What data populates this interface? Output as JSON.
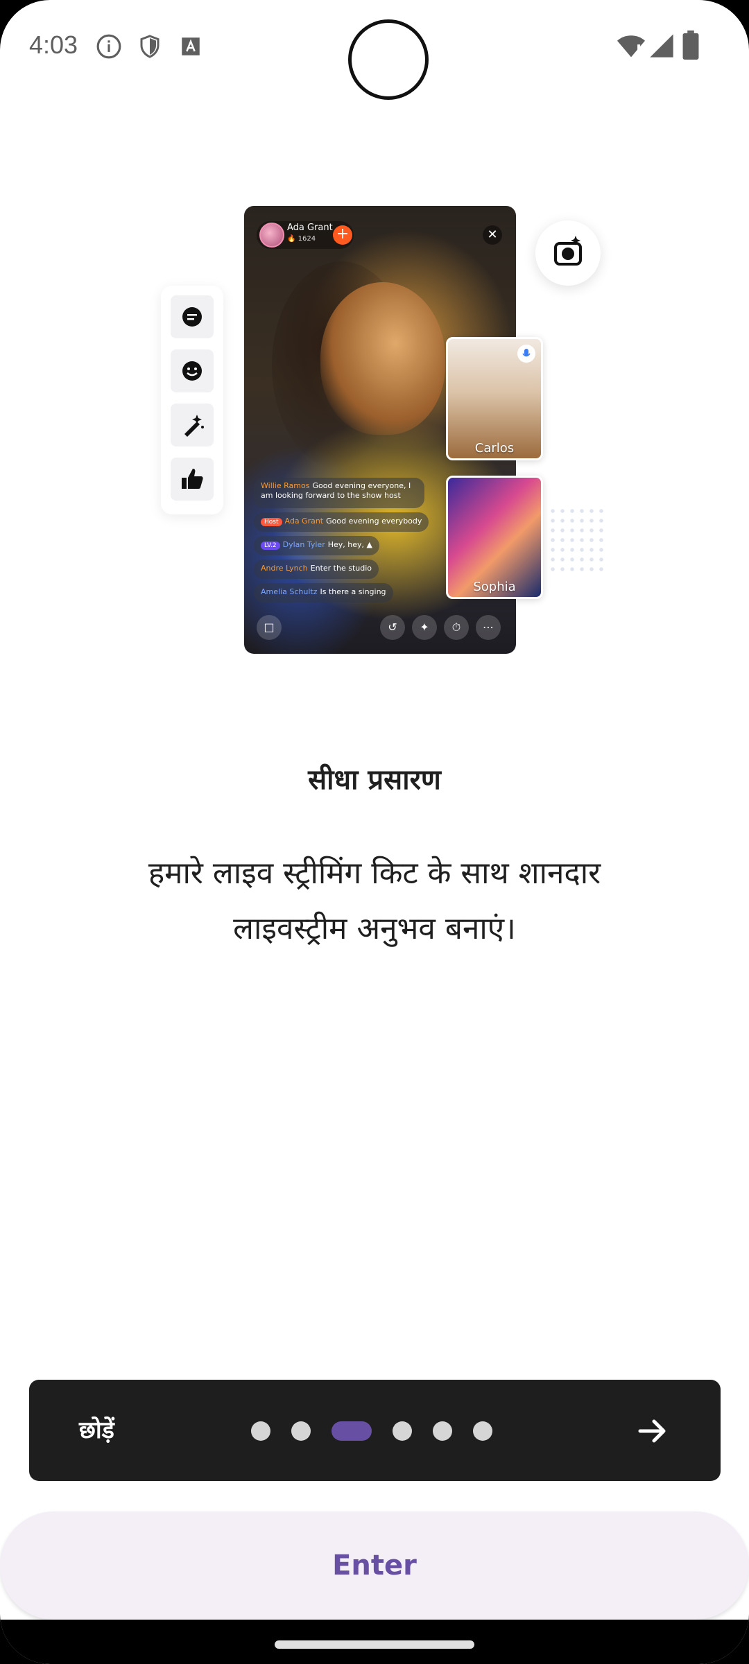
{
  "status_bar": {
    "time": "4:03",
    "icons": [
      "info-icon",
      "shield-icon",
      "a-keyboard-icon",
      "wifi-icon",
      "signal-icon",
      "battery-icon"
    ]
  },
  "illustration": {
    "host": {
      "name": "Ada Grant",
      "score": "1624"
    },
    "chat": [
      {
        "name": "Willie Ramos",
        "text": "Good evening everyone, I am looking forward to the  show host"
      },
      {
        "tag": "Host",
        "name": "Ada Grant",
        "text": "Good evening everybody"
      },
      {
        "tag": "LV.2",
        "name": "Dylan Tyler",
        "text": "Hey, hey,"
      },
      {
        "name": "Andre Lynch",
        "text": "Enter the studio"
      },
      {
        "name": "Amelia Schultz",
        "text": "Is there a singing"
      }
    ],
    "guests": [
      {
        "name": "Carlos"
      },
      {
        "name": "Sophia"
      }
    ]
  },
  "onboarding": {
    "title": "सीधा प्रसारण",
    "description": "हमारे लाइव स्ट्रीमिंग किट के साथ शानदार लाइवस्ट्रीम अनुभव बनाएं।"
  },
  "navigation": {
    "skip_label": "छोड़ें",
    "page_count": 6,
    "active_page": 3
  },
  "enter_button": {
    "label": "Enter"
  },
  "colors": {
    "accent": "#6750a4",
    "nav_bg": "#1e1e1e",
    "enter_bg": "#f4eff7"
  }
}
